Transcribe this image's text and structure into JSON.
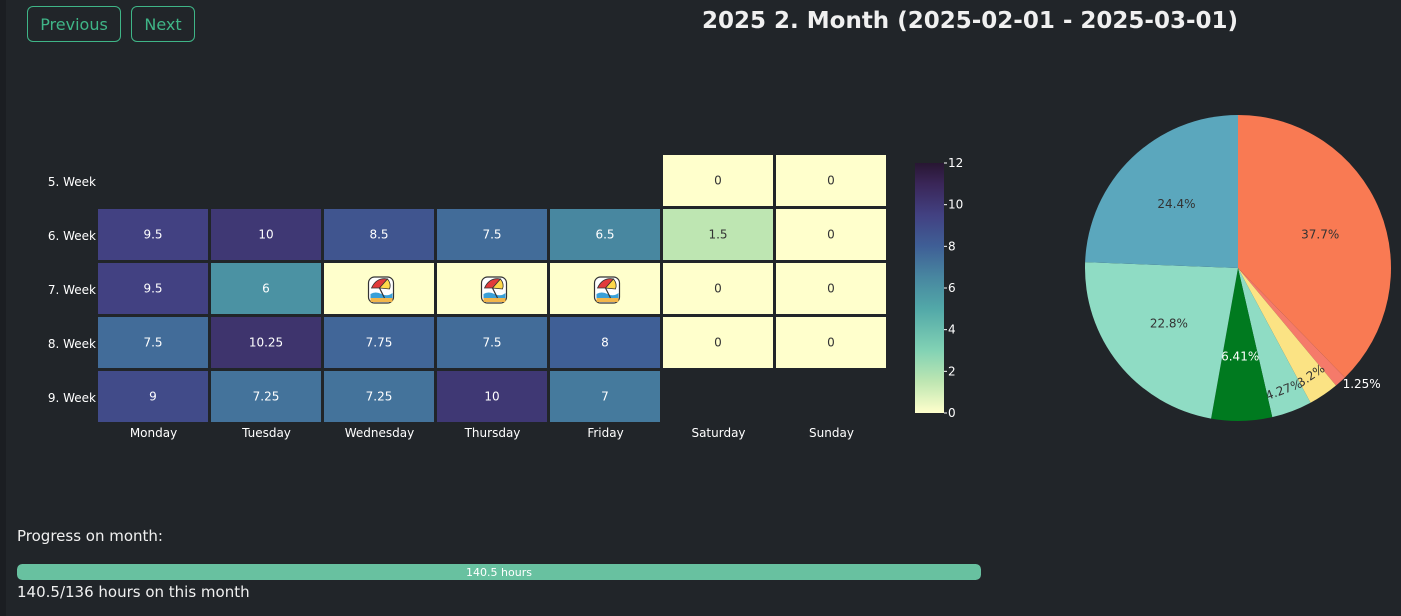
{
  "nav": {
    "previous_label": "Previous",
    "next_label": "Next"
  },
  "header": {
    "title": "2025 2. Month (2025-02-01 - 2025-03-01)"
  },
  "progress": {
    "label": "Progress on month:",
    "bar_text": "140.5 hours",
    "fraction": 1.0,
    "summary": "140.5/136 hours on this month",
    "fill_color": "#68c1a0"
  },
  "chart_data": [
    {
      "type": "heatmap",
      "x_labels": [
        "Monday",
        "Tuesday",
        "Wednesday",
        "Thursday",
        "Friday",
        "Saturday",
        "Sunday"
      ],
      "y_labels": [
        "5. Week",
        "6. Week",
        "7. Week",
        "8. Week",
        "9. Week"
      ],
      "cells": [
        [
          null,
          null,
          null,
          null,
          null,
          "0",
          "0"
        ],
        [
          "9.5",
          "10",
          "8.5",
          "7.5",
          "6.5",
          "1.5",
          "0"
        ],
        [
          "9.5",
          "6",
          "vacation",
          "vacation",
          "vacation",
          "0",
          "0"
        ],
        [
          "7.5",
          "10.25",
          "7.75",
          "7.5",
          "8",
          "0",
          "0"
        ],
        [
          "9",
          "7.25",
          "7.25",
          "10",
          "7",
          null,
          null
        ]
      ],
      "vacation_icon": "beach-umbrella-icon",
      "colorbar": {
        "ticks": [
          "0",
          "2",
          "4",
          "6",
          "8",
          "10",
          "12"
        ],
        "range": [
          0,
          12
        ]
      }
    },
    {
      "type": "pie",
      "slices": [
        {
          "label": "37.7%",
          "value": 37.7,
          "color": "#f97a53"
        },
        {
          "label": "1.25%",
          "value": 1.25,
          "color": "#f57a6a"
        },
        {
          "label": "3.2%",
          "value": 3.2,
          "color": "#fbe384"
        },
        {
          "label": "4.27%",
          "value": 4.27,
          "color": "#8fdcc4"
        },
        {
          "label": "6.41%",
          "value": 6.41,
          "color": "#007a1f"
        },
        {
          "label": "22.8%",
          "value": 22.8,
          "color": "#8fdcc4"
        },
        {
          "label": "24.4%",
          "value": 24.4,
          "color": "#5ba7bd"
        }
      ]
    }
  ]
}
